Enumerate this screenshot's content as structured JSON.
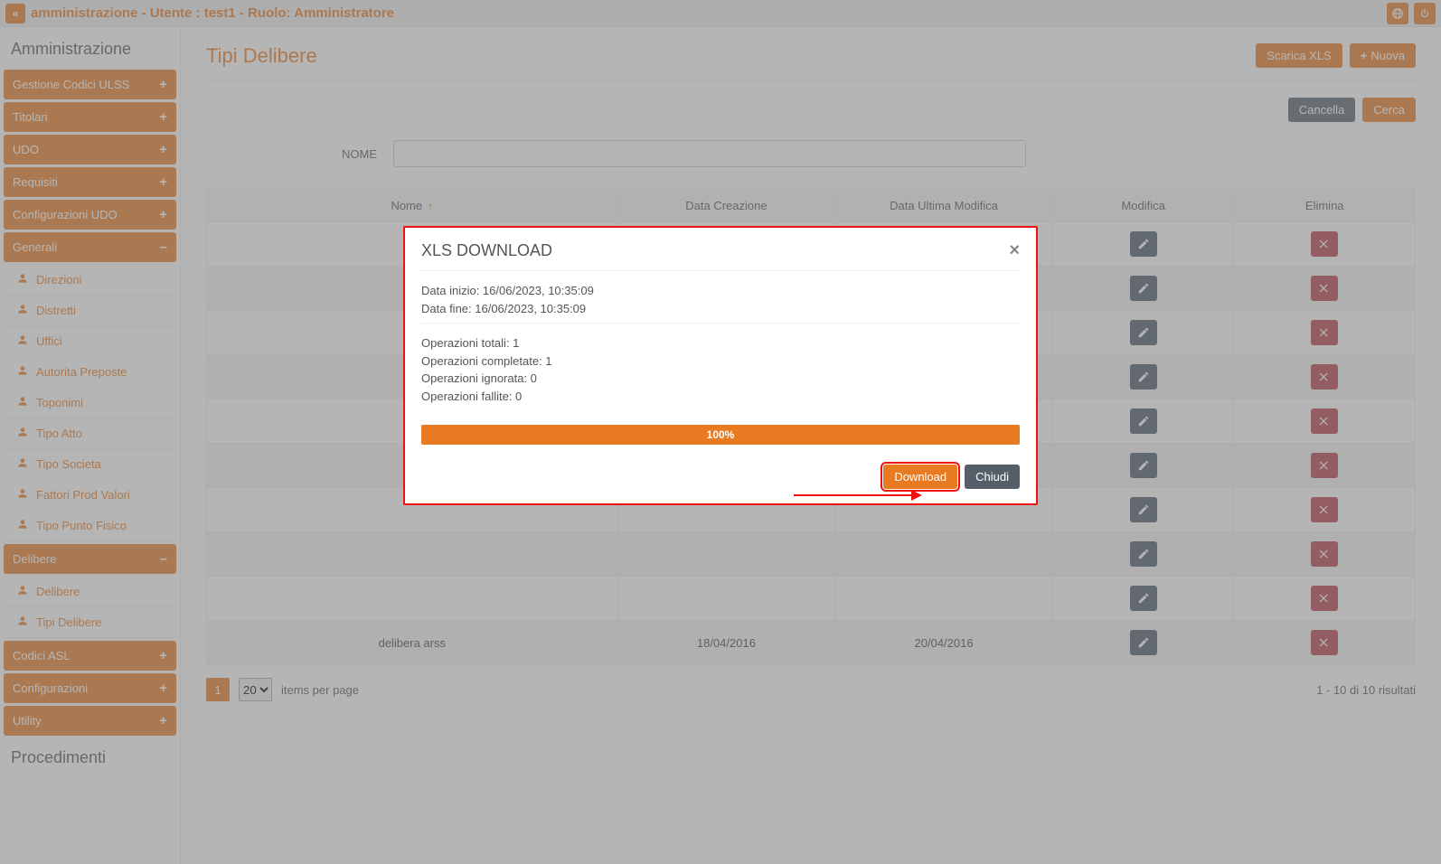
{
  "topbar": {
    "title": "amministrazione - Utente : test1 - Ruolo: Amministratore"
  },
  "sidebar": {
    "heading": "Amministrazione",
    "items": [
      {
        "label": "Gestione Codici ULSS",
        "sign": "+",
        "open": false
      },
      {
        "label": "Titolari",
        "sign": "+",
        "open": false
      },
      {
        "label": "UDO",
        "sign": "+",
        "open": false
      },
      {
        "label": "Requisiti",
        "sign": "+",
        "open": false
      },
      {
        "label": "Configurazioni UDO",
        "sign": "+",
        "open": false
      },
      {
        "label": "Generali",
        "sign": "–",
        "open": true,
        "children": [
          "Direzioni",
          "Distretti",
          "Uffici",
          "Autorita Preposte",
          "Toponimi",
          "Tipo Atto",
          "Tipo Societa",
          "Fattori Prod Valori",
          "Tipo Punto Fisico"
        ]
      },
      {
        "label": "Delibere",
        "sign": "–",
        "open": true,
        "children": [
          "Delibere",
          "Tipi Delibere"
        ]
      },
      {
        "label": "Codici ASL",
        "sign": "+",
        "open": false
      },
      {
        "label": "Configurazioni",
        "sign": "+",
        "open": false
      },
      {
        "label": "Utility",
        "sign": "+",
        "open": false
      }
    ],
    "footer_heading": "Procedimenti"
  },
  "main": {
    "title": "Tipi Delibere",
    "buttons": {
      "download_xls": "Scarica XLS",
      "new": "Nuova",
      "cancel": "Cancella",
      "search": "Cerca"
    },
    "filter_label": "NOME",
    "table": {
      "headers": {
        "nome": "Nome",
        "created": "Data Creazione",
        "modified": "Data Ultima Modifica",
        "edit": "Modifica",
        "delete": "Elimina"
      },
      "rows": [
        {
          "nome": "",
          "created": "",
          "modified": ""
        },
        {
          "nome": "",
          "created": "",
          "modified": ""
        },
        {
          "nome": "",
          "created": "",
          "modified": ""
        },
        {
          "nome": "",
          "created": "",
          "modified": ""
        },
        {
          "nome": "",
          "created": "",
          "modified": ""
        },
        {
          "nome": "",
          "created": "",
          "modified": ""
        },
        {
          "nome": "",
          "created": "",
          "modified": ""
        },
        {
          "nome": "",
          "created": "",
          "modified": ""
        },
        {
          "nome": "",
          "created": "",
          "modified": ""
        },
        {
          "nome": "delibera arss",
          "created": "18/04/2016",
          "modified": "20/04/2016"
        }
      ]
    },
    "pager": {
      "current": "1",
      "page_size": "20",
      "label": "items per page",
      "summary": "1 - 10 di 10 risultati"
    }
  },
  "modal": {
    "title": "XLS DOWNLOAD",
    "start": "Data inizio: 16/06/2023, 10:35:09",
    "end": "Data fine: 16/06/2023, 10:35:09",
    "ops_total": "Operazioni totali: 1",
    "ops_done": "Operazioni completate: 1",
    "ops_ignored": "Operazioni ignorata: 0",
    "ops_failed": "Operazioni fallite: 0",
    "progress": "100%",
    "download": "Download",
    "close": "Chiudi"
  }
}
